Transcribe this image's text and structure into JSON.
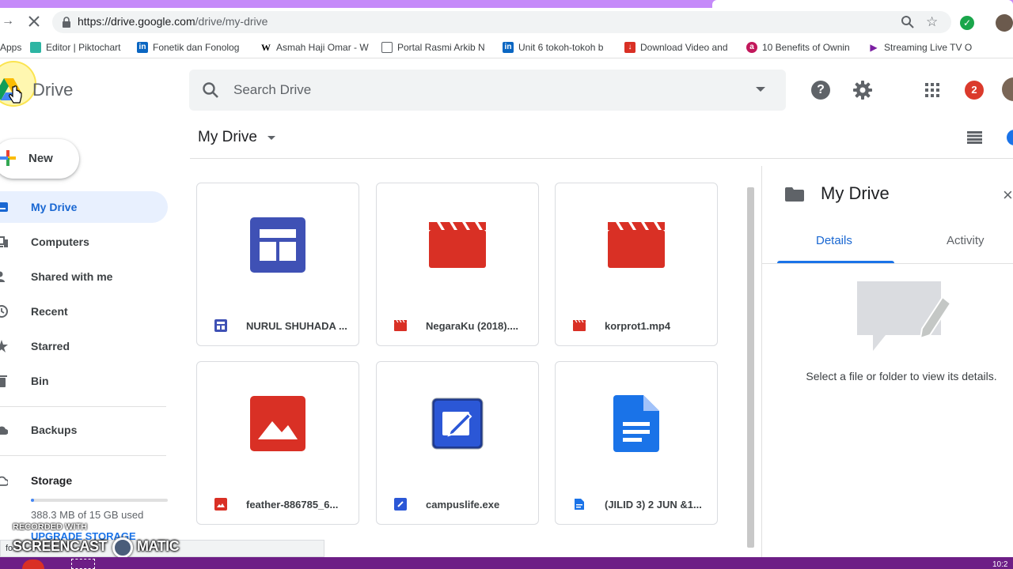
{
  "browser": {
    "url_host": "https://drive.google.com",
    "url_path": "/drive/my-drive",
    "bookmarks": [
      {
        "label": "Apps",
        "icon": "apps-grid-icon"
      },
      {
        "label": "Editor | Piktochart",
        "icon": "piktochart-icon"
      },
      {
        "label": "Fonetik dan Fonolog",
        "icon": "linkedin-icon"
      },
      {
        "label": "Asmah Haji Omar - W",
        "icon": "wikipedia-icon"
      },
      {
        "label": "Portal Rasmi Arkib N",
        "icon": "page-icon"
      },
      {
        "label": "Unit 6 tokoh-tokoh b",
        "icon": "linkedin-icon"
      },
      {
        "label": "Download Video and",
        "icon": "download-icon"
      },
      {
        "label": "10 Benefits of Ownin",
        "icon": "a-icon"
      },
      {
        "label": "Streaming Live TV O",
        "icon": "play-icon"
      }
    ]
  },
  "header": {
    "app_name": "Drive",
    "search_placeholder": "Search Drive",
    "notification_count": "2"
  },
  "sidebar": {
    "new_label": "New",
    "items": [
      {
        "label": "My Drive",
        "icon": "my-drive-icon",
        "active": true
      },
      {
        "label": "Computers",
        "icon": "computers-icon"
      },
      {
        "label": "Shared with me",
        "icon": "shared-icon"
      },
      {
        "label": "Recent",
        "icon": "clock-icon"
      },
      {
        "label": "Starred",
        "icon": "star-icon"
      },
      {
        "label": "Bin",
        "icon": "bin-icon"
      },
      {
        "label": "Backups",
        "icon": "cloud-icon"
      },
      {
        "label": "Storage",
        "icon": "cloud-icon"
      }
    ],
    "storage_used": "388.3 MB of 15 GB used",
    "storage_fraction": 0.026,
    "upgrade_label": "UPGRADE STORAGE",
    "status_url_fragment": "fo"
  },
  "main": {
    "breadcrumb": "My Drive",
    "files": [
      {
        "name": "NURUL SHUHADA ...",
        "type": "form",
        "color": "#3f51b5"
      },
      {
        "name": "NegaraKu (2018)....",
        "type": "video",
        "color": "#d93025"
      },
      {
        "name": "korprot1.mp4",
        "type": "video",
        "color": "#d93025"
      },
      {
        "name": "feather-886785_6...",
        "type": "image",
        "color": "#d93025"
      },
      {
        "name": "campuslife.exe",
        "type": "exe",
        "color": "#2b4bbd"
      },
      {
        "name": "(JILID 3) 2 JUN &1...",
        "type": "doc",
        "color": "#1a73e8"
      }
    ]
  },
  "details": {
    "title": "My Drive",
    "tab_details": "Details",
    "tab_activity": "Activity",
    "empty_text": "Select a file or folder to view its details."
  },
  "watermark": {
    "line1": "RECORDED WITH",
    "line2": "SCREENCAST",
    "line3": "MATIC"
  },
  "taskbar": {
    "time": "10:2"
  }
}
